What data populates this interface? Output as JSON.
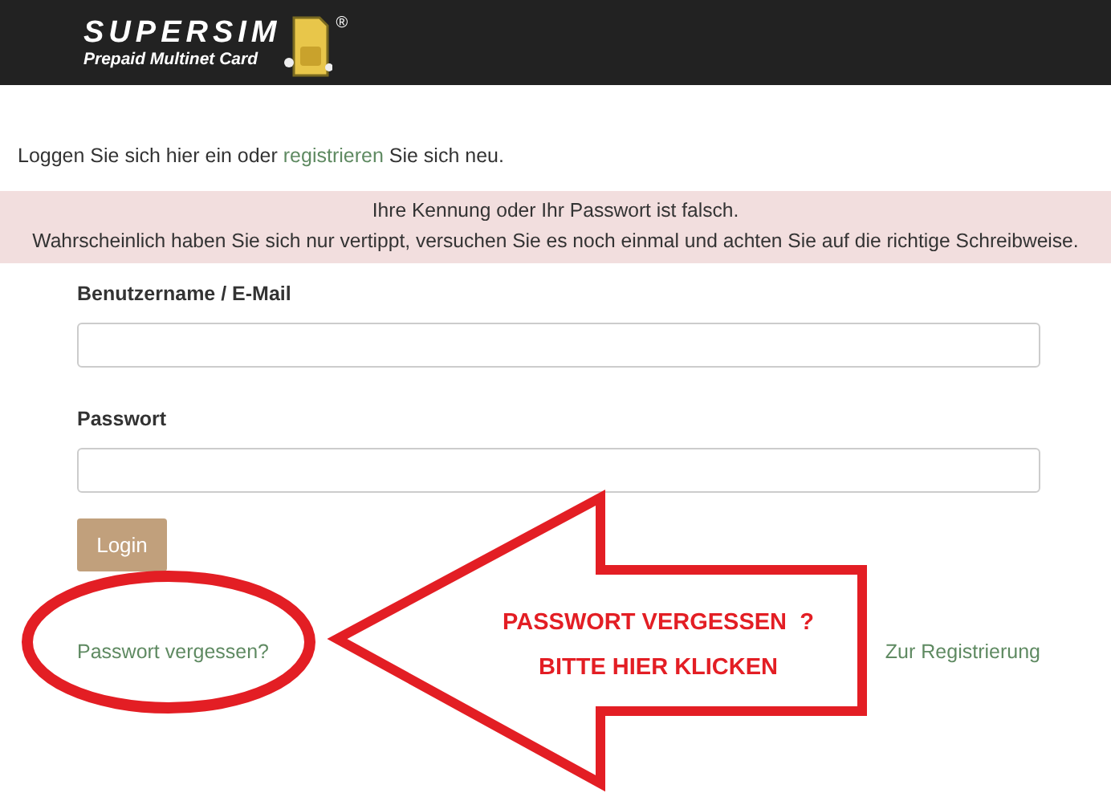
{
  "header": {
    "logo_title": "SUPERSIM",
    "logo_subtitle": "Prepaid Multinet Card",
    "logo_mark": "®"
  },
  "intro": {
    "before": "Loggen Sie sich hier ein oder",
    "link": "registrieren",
    "after": "Sie sich neu."
  },
  "alert": {
    "lines": [
      "Ihre Kennung oder Ihr Passwort ist falsch.",
      "Wahrscheinlich haben Sie sich nur vertippt, versuchen Sie es noch einmal und achten Sie auf die richtige Schreibweise."
    ]
  },
  "form": {
    "fields": [
      {
        "label": "Benutzername / E-Mail"
      },
      {
        "label": "Passwort"
      }
    ],
    "submit": "Login"
  },
  "links": {
    "forgot": "Passwort vergessen?",
    "register": "Zur Registrierung"
  },
  "annotation": {
    "lines": [
      "PASSWORT VERGESSEN  ?",
      "BITTE HIER KLICKEN"
    ]
  }
}
